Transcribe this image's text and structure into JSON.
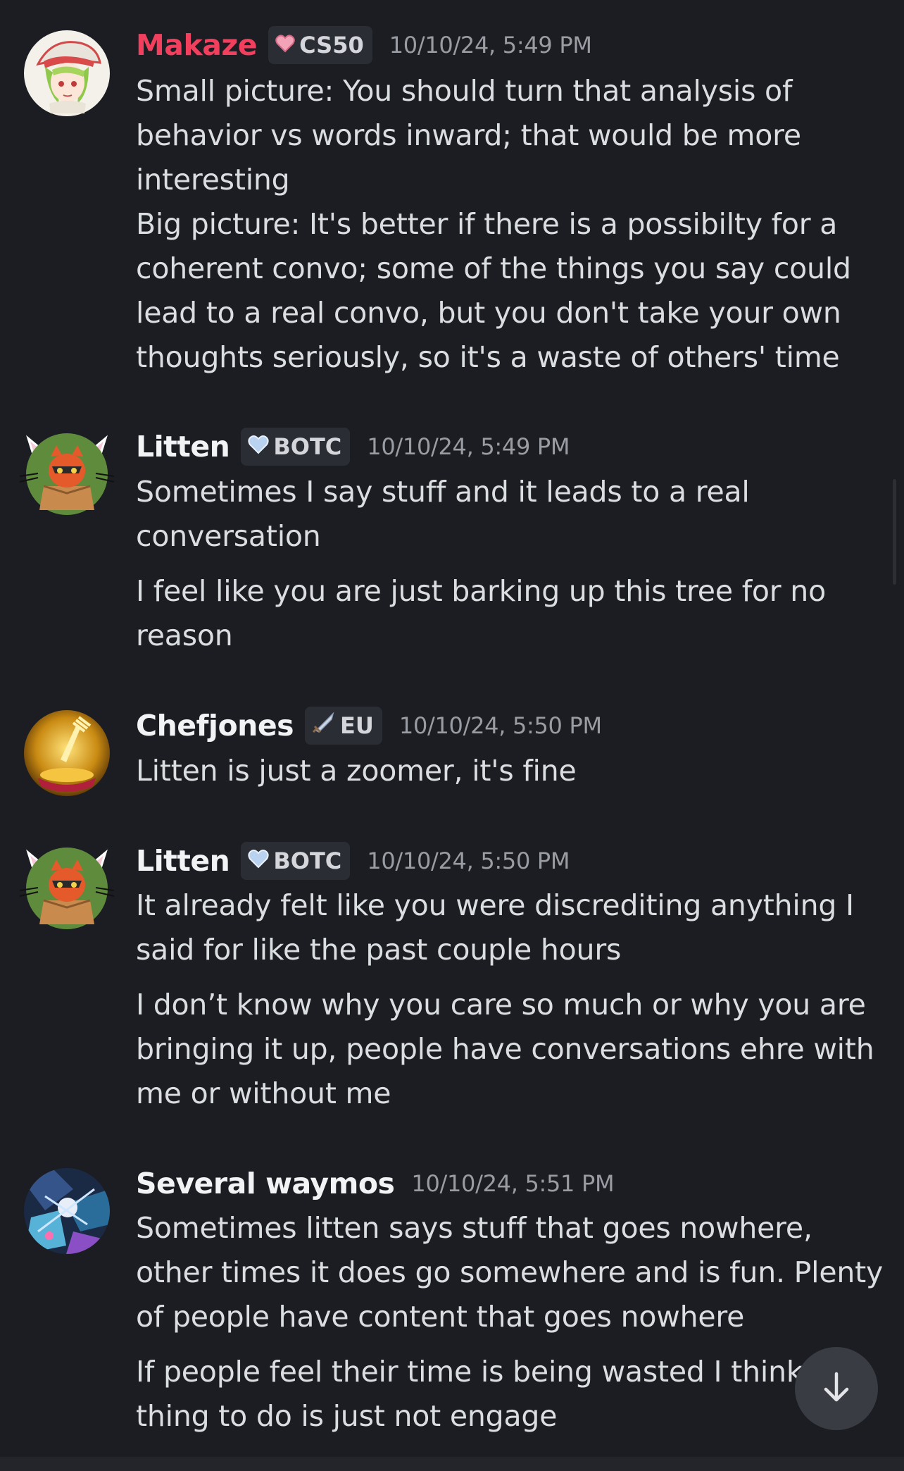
{
  "messages": [
    {
      "username": "Makaze",
      "username_color": "#f23f5e",
      "tag": "CS50",
      "timestamp": "10/10/24, 5:49 PM",
      "lines": [
        "Small picture: You should turn that analysis of",
        "behavior vs words inward; that would be more",
        "interesting",
        "Big picture: It's better if there is a possibilty for a",
        "coherent convo; some of the things you say could",
        "lead to a real convo, but you don't take your own",
        "thoughts seriously, so it's a waste of others' time"
      ]
    },
    {
      "username": "Litten",
      "username_color": "#f2f3f5",
      "tag": "BOTC",
      "timestamp": "10/10/24, 5:49 PM",
      "lines": [
        "Sometimes I say stuff and it leads to a real",
        "conversation",
        "I feel like you are just barking up this tree for no",
        "reason"
      ]
    },
    {
      "username": "Chefjones",
      "username_color": "#f2f3f5",
      "tag": "EU",
      "timestamp": "10/10/24, 5:50 PM",
      "lines": [
        "Litten is just a zoomer, it's fine"
      ]
    },
    {
      "username": "Litten",
      "username_color": "#f2f3f5",
      "tag": "BOTC",
      "timestamp": "10/10/24, 5:50 PM",
      "lines": [
        "It already felt like you were discrediting anything I",
        "said for like the past couple hours",
        "I don’t know why you care so much or why you are",
        "bringing it up, people have conversations ehre with",
        "me or without me"
      ]
    },
    {
      "username": "Several waymos",
      "username_color": "#f2f3f5",
      "timestamp": "10/10/24, 5:51 PM",
      "lines": [
        "Sometimes litten says stuff that goes nowhere,",
        "other times it does go somewhere and is fun. Plenty",
        "of people have content that goes nowhere",
        "If people feel their time is being wasted I think",
        "thing to do is just not engage"
      ]
    }
  ],
  "icons": {
    "scroll_down": "arrow-down-icon",
    "makaze_tag": "heart-icon",
    "litten_tag": "heart-icon",
    "chefjones_tag": "sword-icon"
  },
  "colors": {
    "background": "#1c1d22",
    "text": "#dbdee1",
    "timestamp": "#9a9ca3",
    "tag_background": "#2b2d35"
  }
}
